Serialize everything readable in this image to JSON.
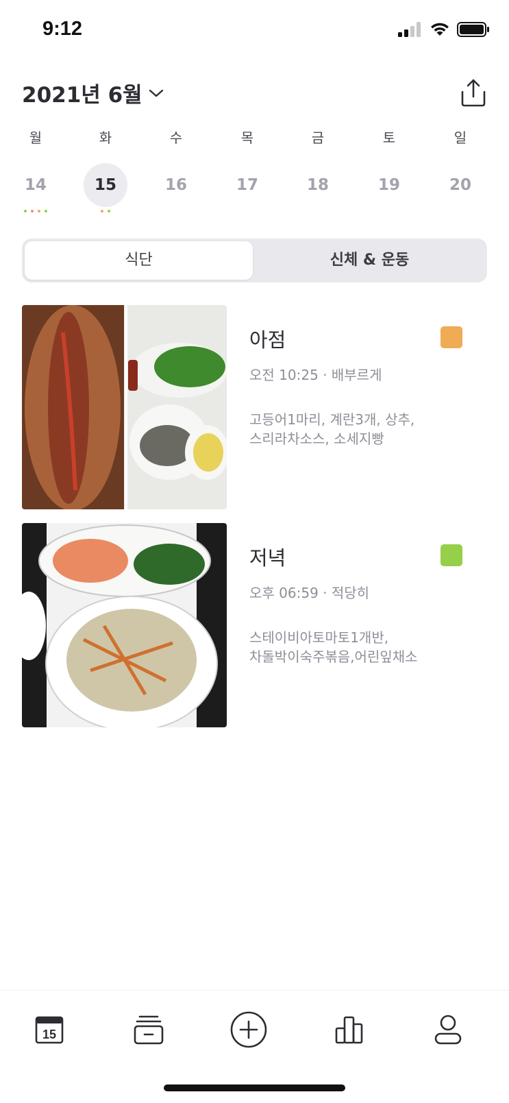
{
  "status": {
    "time": "9:12"
  },
  "header": {
    "month": "2021년 6월"
  },
  "week": [
    {
      "dow": "월",
      "num": "14"
    },
    {
      "dow": "화",
      "num": "15"
    },
    {
      "dow": "수",
      "num": "16"
    },
    {
      "dow": "목",
      "num": "17"
    },
    {
      "dow": "금",
      "num": "18"
    },
    {
      "dow": "토",
      "num": "19"
    },
    {
      "dow": "일",
      "num": "20"
    }
  ],
  "selected_day": "15",
  "segment": {
    "tab1": "식단",
    "tab2": "신체 & 운동"
  },
  "meals": [
    {
      "name": "아점",
      "meta": "오전 10:25 · 배부르게",
      "desc_line1": "고등어1마리, 계란3개, 상추,",
      "desc_line2": "스리라차소스, 소세지빵",
      "tag_color": "#f0ab55"
    },
    {
      "name": "저녁",
      "meta": "오후 06:59 · 적당히",
      "desc_line1": "스테이비아토마토1개반,",
      "desc_line2": "차돌박이숙주볶음,어린잎채소",
      "tag_color": "#96cf4a"
    }
  ],
  "tabbar": {
    "calendar_day": "15"
  },
  "colors": {
    "dot_orange": "#f0ab55",
    "dot_pink": "#f08a8a",
    "dot_green": "#96cf4a",
    "dot_gray": "#c8c8d0"
  }
}
